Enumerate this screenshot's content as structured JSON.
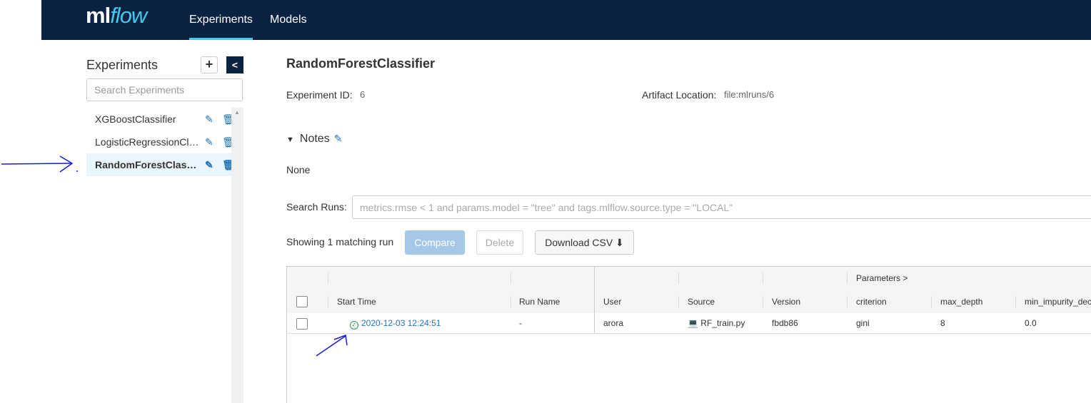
{
  "header": {
    "logo_ml": "ml",
    "logo_flow": "flow",
    "nav": [
      "Experiments",
      "Models"
    ]
  },
  "sidebar": {
    "title": "Experiments",
    "add_icon": "plus-icon",
    "collapse_icon": "chevron-left-icon",
    "search_placeholder": "Search Experiments",
    "experiments": [
      {
        "name": "XGBoostClassifier"
      },
      {
        "name": "LogisticRegressionClassifier"
      },
      {
        "name": "RandomForestClassifier"
      }
    ]
  },
  "main": {
    "title": "RandomForestClassifier",
    "experiment_id_label": "Experiment ID:",
    "experiment_id": "6",
    "artifact_label": "Artifact Location:",
    "artifact_value": "file:mlruns/6",
    "notes_label": "Notes",
    "notes_body": "None",
    "search_runs_label": "Search Runs:",
    "search_runs_placeholder": "metrics.rmse < 1 and params.model = \"tree\" and tags.mlflow.source.type = \"LOCAL\"",
    "showing": "Showing 1 matching run",
    "compare_label": "Compare",
    "delete_label": "Delete",
    "csv_label": "Download CSV"
  },
  "table": {
    "group_header": "Parameters",
    "columns": [
      "Start Time",
      "Run Name",
      "User",
      "Source",
      "Version",
      "criterion",
      "max_depth",
      "min_impurity_dec"
    ],
    "rows": [
      {
        "start_time": "2020-12-03 12:24:51",
        "run_name": "-",
        "user": "arora",
        "source": "RF_train.py",
        "version": "fbdb86",
        "criterion": "gini",
        "max_depth": "8",
        "min_impurity": "0.0"
      }
    ]
  },
  "colors": {
    "header_bg": "#0b2342",
    "accent": "#43c9ed",
    "link": "#2374bb",
    "annotation": "#1a1adf"
  }
}
